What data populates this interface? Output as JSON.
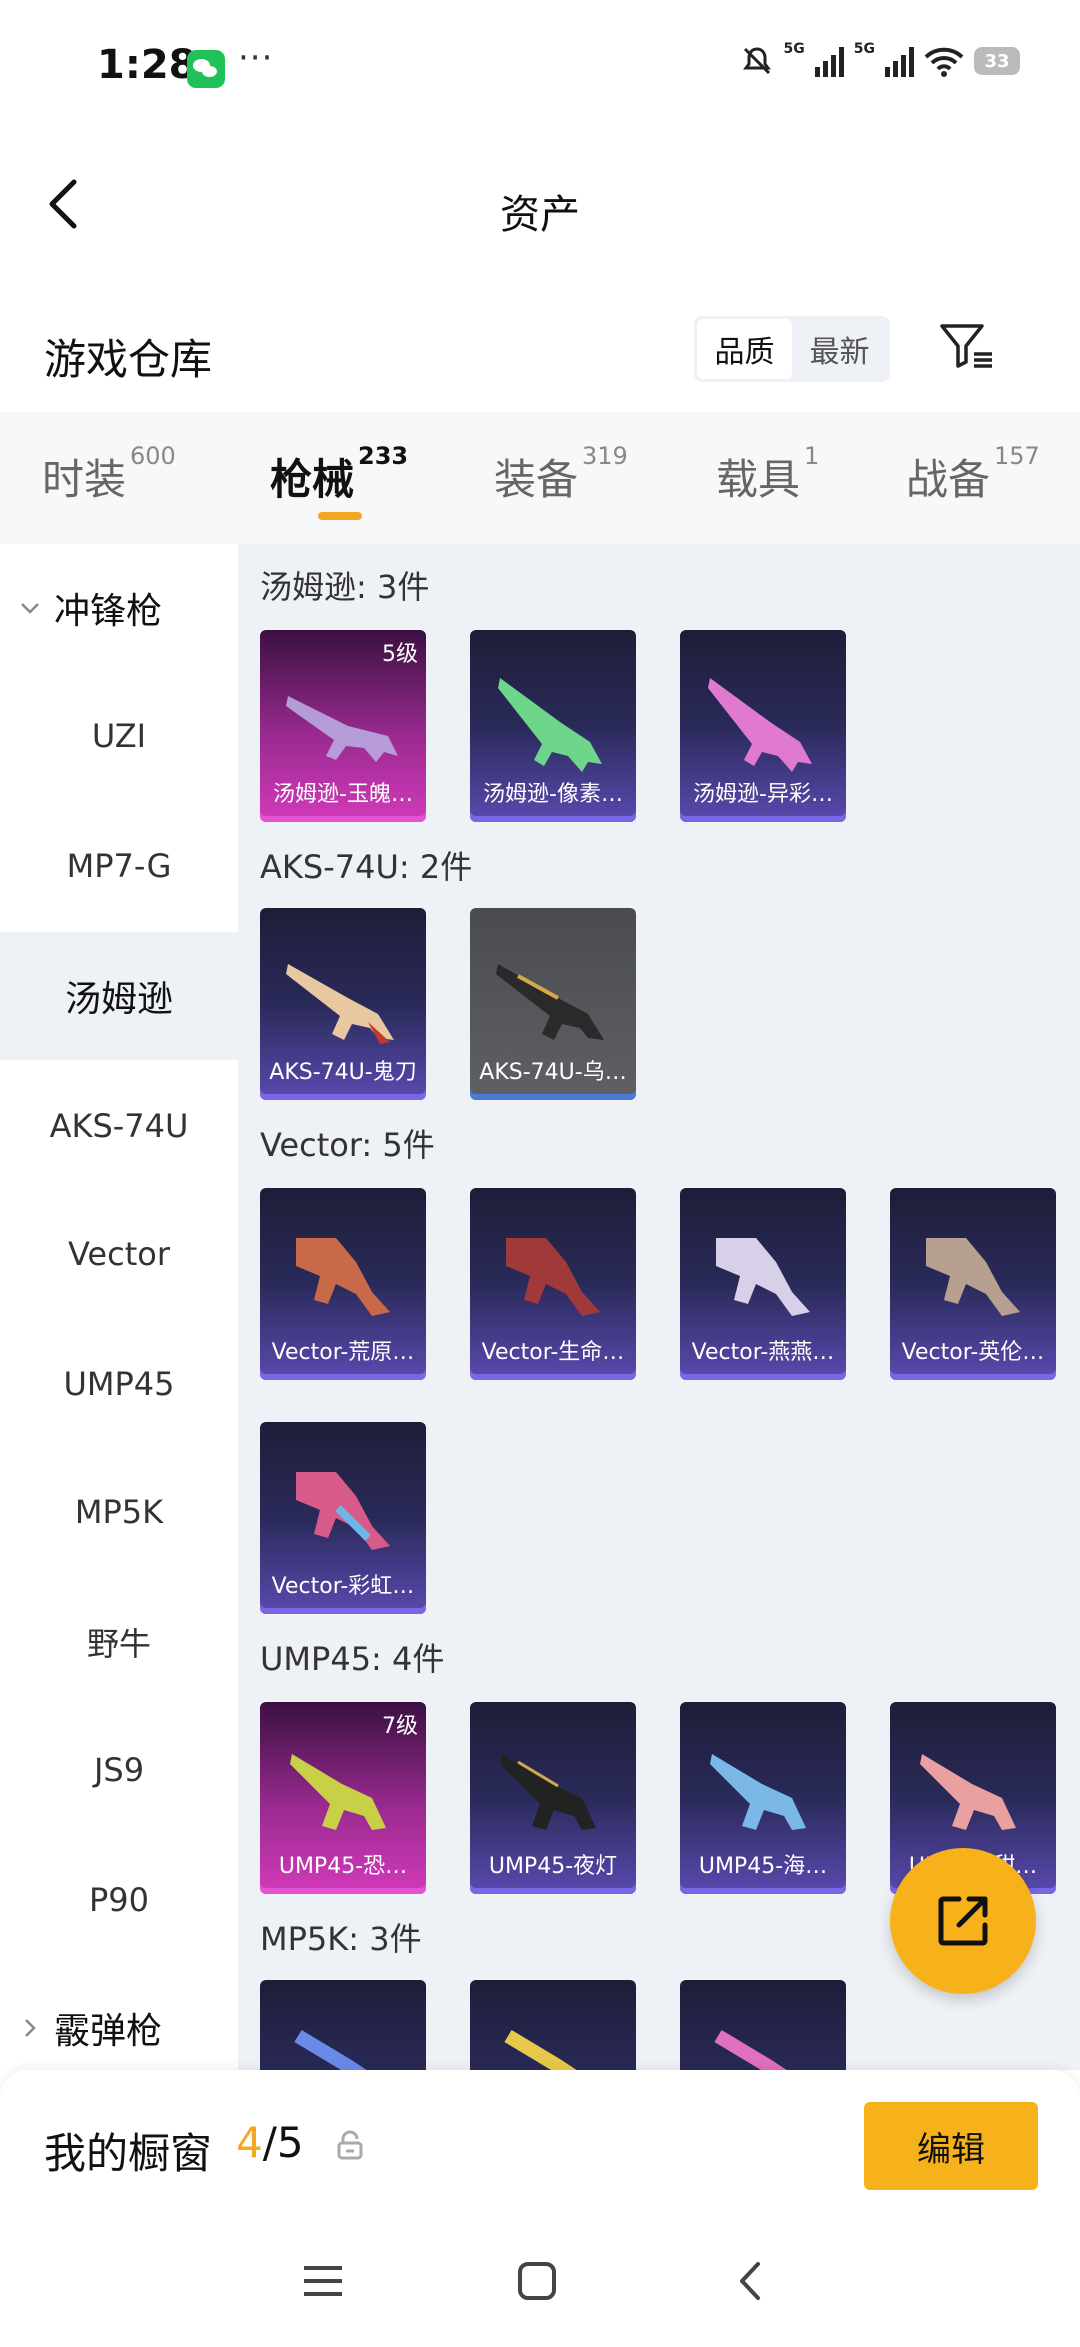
{
  "status_bar": {
    "time": "1:28",
    "dots": "···",
    "net1": "5G",
    "net2": "5G",
    "battery": "33"
  },
  "header": {
    "title": "资产"
  },
  "section": {
    "title": "游戏仓库",
    "sort_options": [
      "品质",
      "最新"
    ],
    "active_sort": "品质"
  },
  "tabs": [
    {
      "label": "时装",
      "count": "600"
    },
    {
      "label": "枪械",
      "count": "233",
      "active": true
    },
    {
      "label": "装备",
      "count": "319"
    },
    {
      "label": "载具",
      "count": "1"
    },
    {
      "label": "战备",
      "count": "157"
    }
  ],
  "sidebar": {
    "group1": "冲锋枪",
    "items": [
      "UZI",
      "MP7-G",
      "汤姆逊",
      "AKS-74U",
      "Vector",
      "UMP45",
      "MP5K",
      "野牛",
      "JS9",
      "P90"
    ],
    "active": "汤姆逊",
    "group2": "霰弹枪"
  },
  "groups": [
    {
      "label": "汤姆逊: 3件",
      "items": [
        {
          "name": "汤姆逊-玉魄…",
          "level": "5级",
          "rarity": "pink"
        },
        {
          "name": "汤姆逊-像素…",
          "rarity": "purple"
        },
        {
          "name": "汤姆逊-异彩…",
          "rarity": "purple"
        }
      ]
    },
    {
      "label": "AKS-74U: 2件",
      "items": [
        {
          "name": "AKS-74U-鬼刀",
          "rarity": "purple"
        },
        {
          "name": "AKS-74U-乌…",
          "rarity": "gray"
        }
      ]
    },
    {
      "label": "Vector: 5件",
      "items": [
        {
          "name": "Vector-荒原…",
          "rarity": "purple"
        },
        {
          "name": "Vector-生命…",
          "rarity": "purple"
        },
        {
          "name": "Vector-燕燕…",
          "rarity": "purple"
        },
        {
          "name": "Vector-英伦…",
          "rarity": "purple"
        },
        {
          "name": "Vector-彩虹…",
          "rarity": "purple"
        }
      ]
    },
    {
      "label": "UMP45: 4件",
      "items": [
        {
          "name": "UMP45-恐…",
          "level": "7级",
          "rarity": "pink"
        },
        {
          "name": "UMP45-夜灯",
          "rarity": "purple"
        },
        {
          "name": "UMP45-海…",
          "rarity": "purple"
        },
        {
          "name": "UMP45-甜…",
          "rarity": "purple"
        }
      ]
    },
    {
      "label": "MP5K: 3件",
      "items": []
    }
  ],
  "showcase": {
    "title": "我的橱窗",
    "current": "4",
    "total": "/5",
    "edit_label": "编辑"
  },
  "colors": {
    "accent": "#f7b21b",
    "purple_card": "#2a2a5a",
    "pink_card": "#d23ab9"
  }
}
